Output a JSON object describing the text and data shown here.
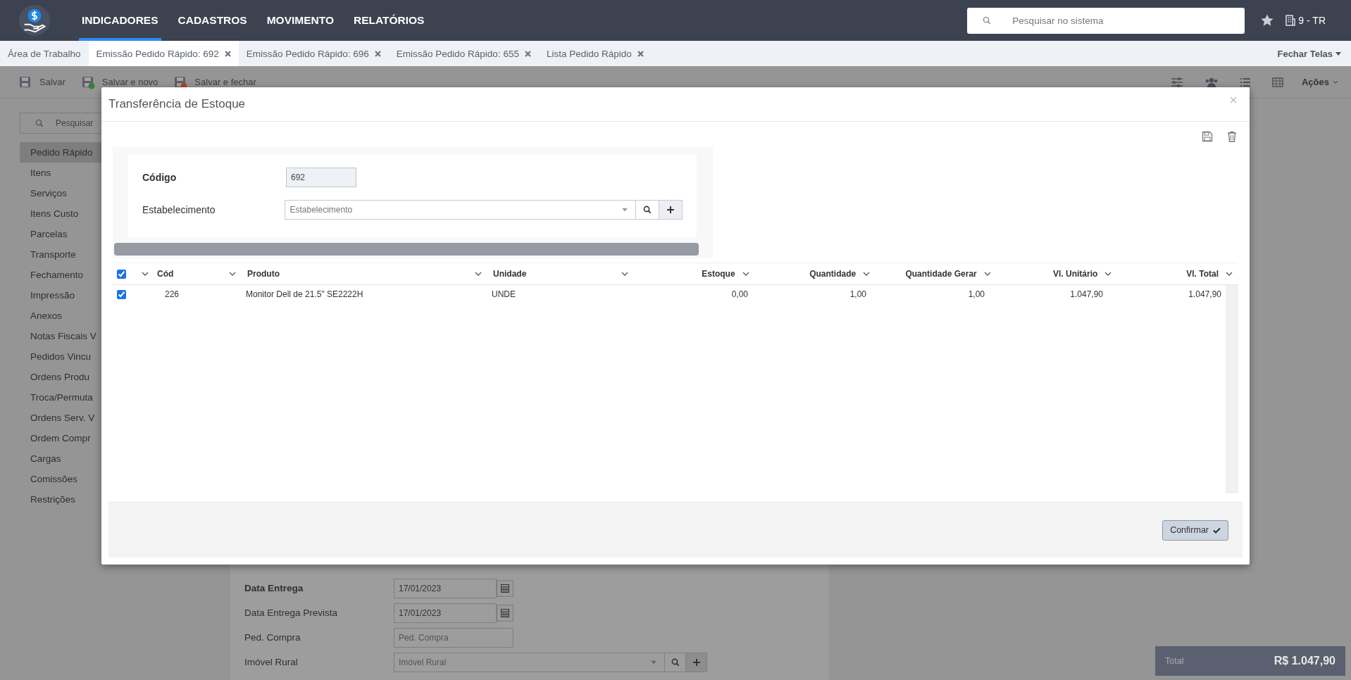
{
  "nav": {
    "items": [
      {
        "label": "INDICADORES",
        "selected": true
      },
      {
        "label": "CADASTROS",
        "selected": false
      },
      {
        "label": "MOVIMENTO",
        "selected": false
      },
      {
        "label": "RELATÓRIOS",
        "selected": false
      }
    ],
    "search": {
      "placeholder": "Pesquisar no sistema"
    },
    "company": "9 - TR"
  },
  "tabs": {
    "items": [
      {
        "label": "Área de Trabalho",
        "selected": false,
        "closable": false
      },
      {
        "label": "Emissão Pedido Rápido: 692",
        "selected": true,
        "closable": true
      },
      {
        "label": "Emissão Pedido Rápido: 696",
        "selected": false,
        "closable": true
      },
      {
        "label": "Emissão Pedido Rápido: 655",
        "selected": false,
        "closable": true
      },
      {
        "label": "Lista Pedido Rápido",
        "selected": false,
        "closable": true
      }
    ],
    "close_all": "Fechar Telas"
  },
  "toolbar": {
    "buttons": [
      {
        "label": "Salvar",
        "kind": "save"
      },
      {
        "label": "Salvar e novo",
        "kind": "new"
      },
      {
        "label": "Salvar e fechar",
        "kind": "close"
      }
    ],
    "actions": "Ações"
  },
  "sidebar": {
    "search": {
      "placeholder": "Pesquisar"
    },
    "items": [
      {
        "label": "Pedido Rápido",
        "selected": true
      },
      {
        "label": "Itens",
        "selected": false
      },
      {
        "label": "Serviços",
        "selected": false
      },
      {
        "label": "Itens Custo",
        "selected": false
      },
      {
        "label": "Parcelas",
        "selected": false
      },
      {
        "label": "Transporte",
        "selected": false
      },
      {
        "label": "Fechamento",
        "selected": false
      },
      {
        "label": "Impressão",
        "selected": false
      },
      {
        "label": "Anexos",
        "selected": false
      },
      {
        "label": "Notas Fiscais V",
        "selected": false
      },
      {
        "label": "Pedidos Vincu",
        "selected": false
      },
      {
        "label": "Ordens Produ",
        "selected": false
      },
      {
        "label": "Troca/Permuta",
        "selected": false
      },
      {
        "label": "Ordens Serv. V",
        "selected": false
      },
      {
        "label": "Ordem Compr",
        "selected": false
      },
      {
        "label": "Cargas",
        "selected": false
      },
      {
        "label": "Comissões",
        "selected": false
      },
      {
        "label": "Restrições",
        "selected": false
      }
    ]
  },
  "form": {
    "fields": [
      {
        "label": "Data Entrega",
        "kind": "date",
        "value": "17/01/2023",
        "required": true
      },
      {
        "label": "Data Entrega Prevista",
        "kind": "date",
        "value": "17/01/2023",
        "required": false
      },
      {
        "label": "Ped. Compra",
        "kind": "text",
        "placeholder": "Ped. Compra",
        "required": false
      },
      {
        "label": "Imóvel Rural",
        "kind": "select",
        "placeholder": "Imóvel Rural",
        "required": false
      }
    ]
  },
  "total": {
    "label": "Total",
    "value": "R$ 1.047,90"
  },
  "modal": {
    "title": "Transferência de Estoque",
    "fields": [
      {
        "label": "Código",
        "kind": "readonly",
        "value": "692",
        "required": true
      },
      {
        "label": "Estabelecimento",
        "kind": "select",
        "placeholder": "Estabelecimento",
        "required": false
      }
    ],
    "table": {
      "all_checked": true,
      "columns": [
        "Cód",
        "Produto",
        "Unidade",
        "Estoque",
        "Quantidade",
        "Quantidade Gerar",
        "Vl. Unitário",
        "Vl. Total"
      ],
      "rows": [
        {
          "checked": true,
          "cells": [
            "226",
            "Monitor Dell de 21.5\" SE2222H",
            "UNDE",
            "0,00",
            "1,00",
            "1,00",
            "1.047,90",
            "1.047,90"
          ]
        }
      ]
    },
    "confirm": "Confirmar"
  }
}
